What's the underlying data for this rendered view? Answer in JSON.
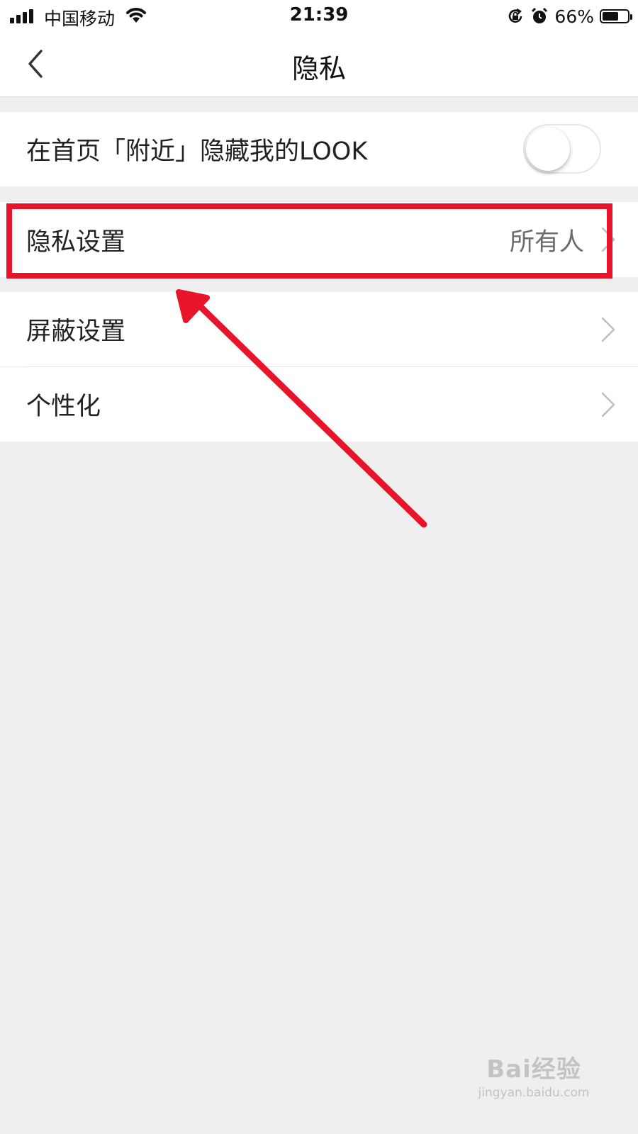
{
  "status_bar": {
    "carrier": "中国移动",
    "time": "21:39",
    "battery_percent": "66%",
    "battery_level": 0.66,
    "icons": [
      "signal-icon",
      "wifi-icon",
      "rotation-lock-icon",
      "alarm-icon",
      "battery-icon"
    ]
  },
  "navbar": {
    "back_icon": "chevron-left-icon",
    "title": "隐私"
  },
  "settings": {
    "hide_nearby": {
      "label": "在首页「附近」隐藏我的LOOK",
      "enabled": false
    },
    "privacy": {
      "label": "隐私设置",
      "value": "所有人"
    },
    "block": {
      "label": "屏蔽设置"
    },
    "personalize": {
      "label": "个性化"
    }
  },
  "annotation": {
    "color": "#e8142a"
  },
  "watermark": {
    "main": "Bai经验",
    "sub": "jingyan.baidu.com"
  },
  "colors": {
    "background": "#efefef",
    "row_background": "#ffffff",
    "toggle_border": "#e6e6e6"
  }
}
